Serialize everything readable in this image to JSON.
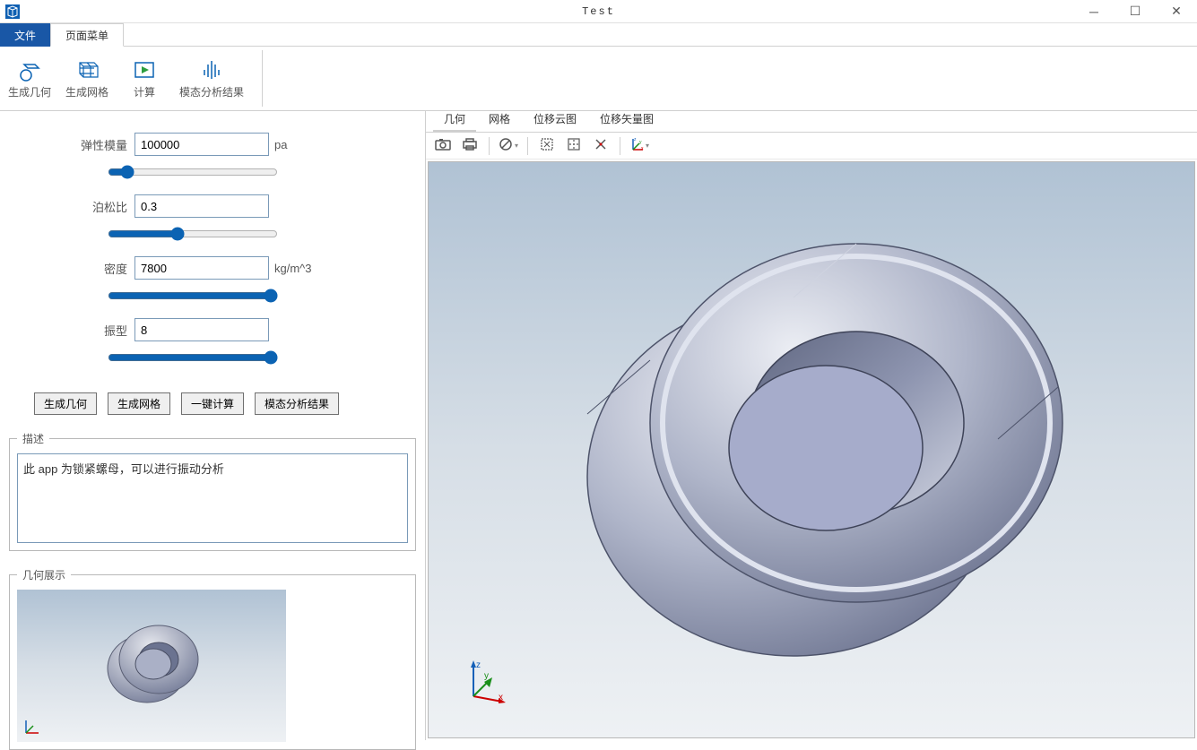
{
  "window": {
    "title": "Test"
  },
  "menu": {
    "file": "文件",
    "page": "页面菜单"
  },
  "ribbon": {
    "gen_geom": "生成几何",
    "gen_mesh": "生成网格",
    "compute": "计算",
    "modal_result": "模态分析结果"
  },
  "params": {
    "youngs_label": "弹性模量",
    "youngs_value": "100000",
    "youngs_unit": "pa",
    "poisson_label": "泊松比",
    "poisson_value": "0.3",
    "density_label": "密度",
    "density_value": "7800",
    "density_unit": "kg/m^3",
    "mode_label": "振型",
    "mode_value": "8"
  },
  "buttons": {
    "gen_geom": "生成几何",
    "gen_mesh": "生成网格",
    "one_click": "一键计算",
    "modal_result": "模态分析结果"
  },
  "desc": {
    "legend": "描述",
    "text": "此 app 为锁紧螺母，可以进行振动分析"
  },
  "geom_preview": {
    "legend": "几何展示"
  },
  "viewer_tabs": {
    "geom": "几何",
    "mesh": "网格",
    "contour": "位移云图",
    "vector": "位移矢量图"
  }
}
